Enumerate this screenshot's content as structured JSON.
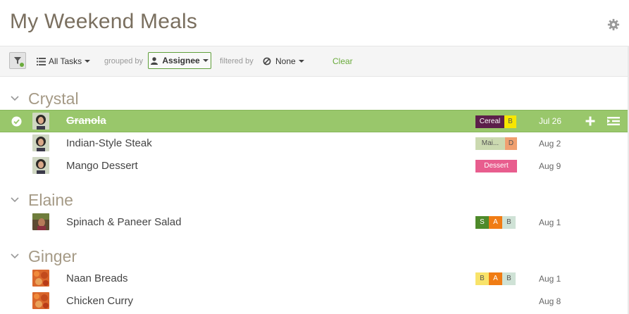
{
  "page": {
    "title": "My Weekend Meals",
    "settings_icon": "gear-icon"
  },
  "toolbar": {
    "filter_icon": "filter-icon",
    "view_label": "All Tasks",
    "grouped_by_label": "grouped by",
    "group_value": "Assignee",
    "filtered_by_label": "filtered by",
    "filter_value": "None",
    "clear_label": "Clear"
  },
  "groups": [
    {
      "name": "Crystal",
      "tasks": [
        {
          "name": "Granola",
          "date": "Jul 26",
          "completed": true,
          "selected": true,
          "tags": [
            {
              "label": "Cereal",
              "color": "#5c1f4a",
              "text": "#ffffff"
            },
            {
              "label": "B",
              "color": "#f7e600",
              "text": "#555555"
            }
          ]
        },
        {
          "name": "Indian-Style Steak",
          "date": "Aug 2",
          "completed": false,
          "tags": [
            {
              "label": "Mai...",
              "color": "#cbd9b0",
              "text": "#555555"
            },
            {
              "label": "D",
              "color": "#f0a070",
              "text": "#555555"
            }
          ]
        },
        {
          "name": "Mango Dessert",
          "date": "Aug 9",
          "completed": false,
          "tags": [
            {
              "label": "Dessert",
              "color": "#e85d8e",
              "text": "#ffffff"
            }
          ]
        }
      ]
    },
    {
      "name": "Elaine",
      "tasks": [
        {
          "name": "Spinach & Paneer Salad",
          "date": "Aug 1",
          "completed": false,
          "tags": [
            {
              "label": "S",
              "color": "#4e8a2a",
              "text": "#ffffff"
            },
            {
              "label": "A",
              "color": "#f07c14",
              "text": "#ffffff"
            },
            {
              "label": "B",
              "color": "#cfe2d6",
              "text": "#555555"
            }
          ]
        }
      ]
    },
    {
      "name": "Ginger",
      "tasks": [
        {
          "name": "Naan Breads",
          "date": "Aug 1",
          "completed": false,
          "tags": [
            {
              "label": "B",
              "color": "#f8e36a",
              "text": "#555555"
            },
            {
              "label": "A",
              "color": "#f07c14",
              "text": "#ffffff"
            },
            {
              "label": "B",
              "color": "#cfe2d6",
              "text": "#555555"
            }
          ]
        },
        {
          "name": "Chicken Curry",
          "date": "Aug 8",
          "completed": false,
          "tags": []
        }
      ]
    }
  ],
  "colors": {
    "accent_green": "#6aab3c",
    "selected_row": "#99c76b",
    "title_brown": "#7a6f5f",
    "group_header": "#a59a86"
  }
}
